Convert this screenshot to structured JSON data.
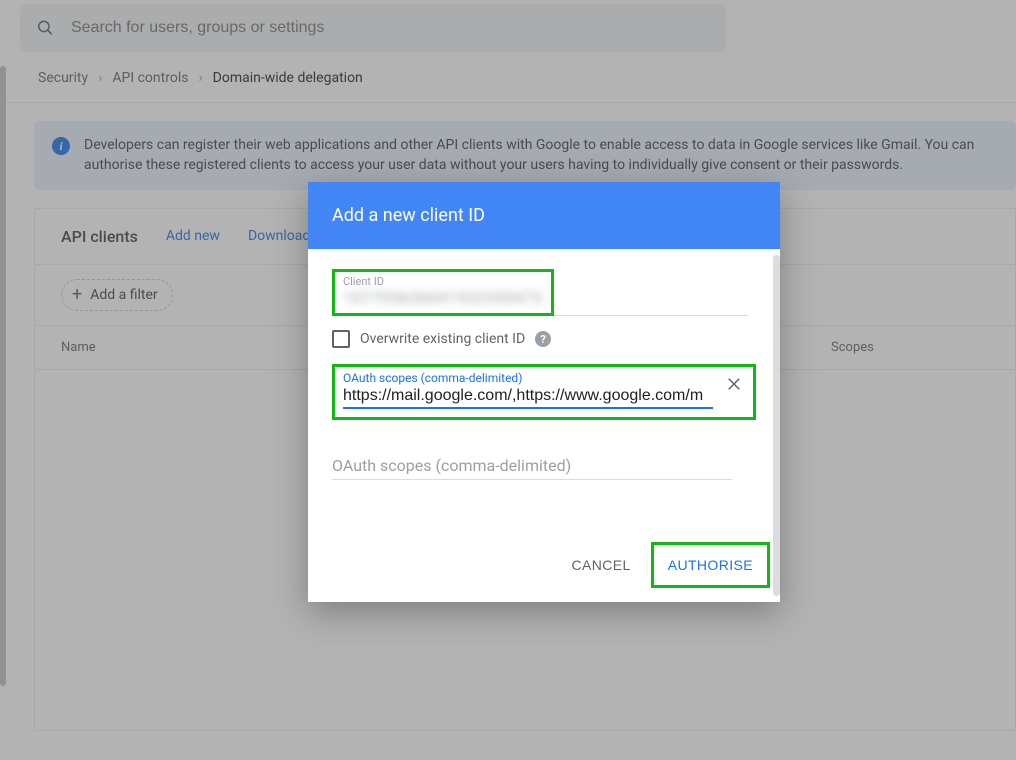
{
  "search": {
    "placeholder": "Search for users, groups or settings"
  },
  "breadcrumb": {
    "a": "Security",
    "b": "API controls",
    "c": "Domain-wide delegation"
  },
  "info_text": "Developers can register their web applications and other API clients with Google to enable access to data in Google services like Gmail. You can authorise these registered clients to access your user data without your users having to individually give consent or their passwords.",
  "panel": {
    "title": "API clients",
    "add_new": "Add new",
    "download": "Download client info",
    "add_filter": "Add a filter"
  },
  "columns": {
    "name": "Name",
    "scopes": "Scopes"
  },
  "modal": {
    "title": "Add a new client ID",
    "client_id_label": "Client ID",
    "client_id_value": "107705636041532355473",
    "overwrite_label": "Overwrite existing client ID",
    "scope_label": "OAuth scopes (comma-delimited)",
    "scope_value": "https://mail.google.com/,https://www.google.com/m",
    "scope_placeholder": "OAuth scopes (comma-delimited)",
    "cancel": "CANCEL",
    "authorise": "AUTHORISE"
  }
}
